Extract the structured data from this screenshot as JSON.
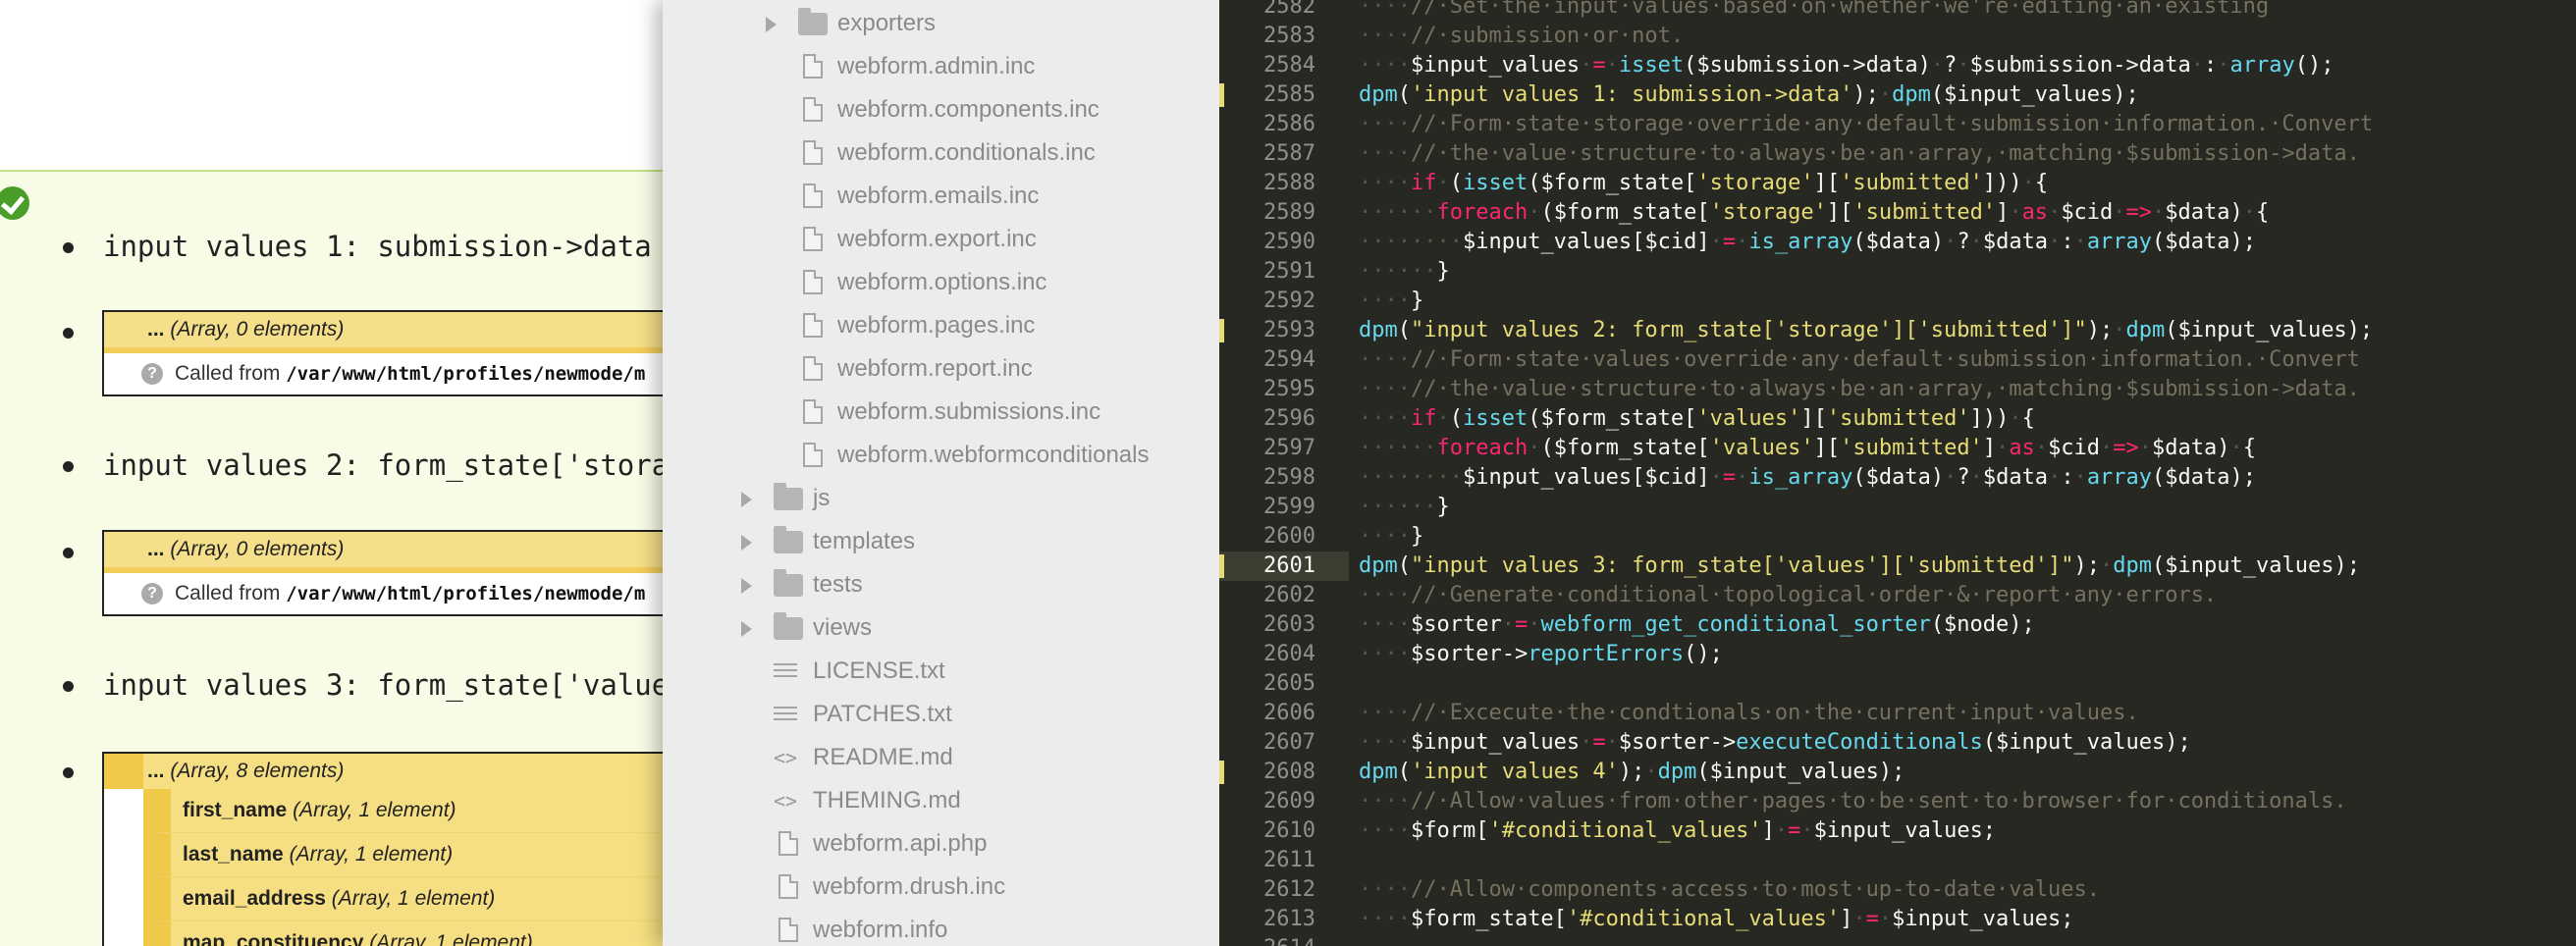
{
  "left_pane": {
    "lines": [
      {
        "text": "input values 1: submission->data"
      },
      {
        "text": "input values 2: form_state['stora"
      },
      {
        "text": "input values 3: form_state['value"
      }
    ],
    "krumo_small": [
      {
        "ellipsis": "...",
        "type": "(Array, 0 elements)",
        "called_from": "Called from",
        "path": "/var/www/html/profiles/newmode/m"
      },
      {
        "ellipsis": "...",
        "type": "(Array, 0 elements)",
        "called_from": "Called from",
        "path": "/var/www/html/profiles/newmode/m"
      }
    ],
    "krumo_big": {
      "ellipsis": "...",
      "type": "(Array, 8 elements)",
      "children": [
        {
          "name": "first_name",
          "type": "(Array, 1 element)"
        },
        {
          "name": "last_name",
          "type": "(Array, 1 element)"
        },
        {
          "name": "email_address",
          "type": "(Array, 1 element)"
        },
        {
          "name": "map_constituency",
          "type": "(Array, 1 element)"
        }
      ]
    }
  },
  "file_tree": {
    "items": [
      {
        "label": "exporters",
        "kind": "folder",
        "expandable": true,
        "depth": 1
      },
      {
        "label": "webform.admin.inc",
        "kind": "file",
        "depth": 1
      },
      {
        "label": "webform.components.inc",
        "kind": "file",
        "depth": 1
      },
      {
        "label": "webform.conditionals.inc",
        "kind": "file",
        "depth": 1
      },
      {
        "label": "webform.emails.inc",
        "kind": "file",
        "depth": 1
      },
      {
        "label": "webform.export.inc",
        "kind": "file",
        "depth": 1
      },
      {
        "label": "webform.options.inc",
        "kind": "file",
        "depth": 1
      },
      {
        "label": "webform.pages.inc",
        "kind": "file",
        "depth": 1
      },
      {
        "label": "webform.report.inc",
        "kind": "file",
        "depth": 1
      },
      {
        "label": "webform.submissions.inc",
        "kind": "file",
        "depth": 1
      },
      {
        "label": "webform.webformconditionals",
        "kind": "file",
        "depth": 1
      },
      {
        "label": "js",
        "kind": "folder",
        "expandable": true,
        "depth": 0
      },
      {
        "label": "templates",
        "kind": "folder",
        "expandable": true,
        "depth": 0
      },
      {
        "label": "tests",
        "kind": "folder",
        "expandable": true,
        "depth": 0
      },
      {
        "label": "views",
        "kind": "folder",
        "expandable": true,
        "depth": 0
      },
      {
        "label": "LICENSE.txt",
        "kind": "text",
        "depth": 0
      },
      {
        "label": "PATCHES.txt",
        "kind": "text",
        "depth": 0
      },
      {
        "label": "README.md",
        "kind": "markdown",
        "depth": 0
      },
      {
        "label": "THEMING.md",
        "kind": "markdown",
        "depth": 0
      },
      {
        "label": "webform.api.php",
        "kind": "file",
        "depth": 0
      },
      {
        "label": "webform.drush.inc",
        "kind": "file",
        "depth": 0
      },
      {
        "label": "webform.info",
        "kind": "file",
        "depth": 0
      }
    ]
  },
  "editor": {
    "active_line": "2601",
    "lines": [
      {
        "num": "2582",
        "tokens": [
          [
            "ws",
            "····"
          ],
          [
            "comment",
            "//·Set·the·input·values·based·on·whether·we're·editing·an·existing"
          ]
        ]
      },
      {
        "num": "2583",
        "tokens": [
          [
            "ws",
            "····"
          ],
          [
            "comment",
            "//·submission·or·not."
          ]
        ]
      },
      {
        "num": "2584",
        "tokens": [
          [
            "ws",
            "····"
          ],
          [
            "var",
            "$input_values"
          ],
          [
            "ws",
            "·"
          ],
          [
            "op",
            "="
          ],
          [
            "ws",
            "·"
          ],
          [
            "fn",
            "isset"
          ],
          [
            "plain",
            "($submission->data)"
          ],
          [
            "ws",
            "·"
          ],
          [
            "plain",
            "?"
          ],
          [
            "ws",
            "·"
          ],
          [
            "plain",
            "$submission->data"
          ],
          [
            "ws",
            "·"
          ],
          [
            "plain",
            ":"
          ],
          [
            "ws",
            "·"
          ],
          [
            "fn",
            "array"
          ],
          [
            "plain",
            "();"
          ]
        ]
      },
      {
        "num": "2585",
        "mark": true,
        "tokens": [
          [
            "fn",
            "dpm"
          ],
          [
            "plain",
            "("
          ],
          [
            "str",
            "'input values 1: submission->data'"
          ],
          [
            "plain",
            ");"
          ],
          [
            "ws",
            "·"
          ],
          [
            "fn",
            "dpm"
          ],
          [
            "plain",
            "($input_values);"
          ]
        ]
      },
      {
        "num": "2586",
        "tokens": [
          [
            "ws",
            "····"
          ],
          [
            "comment",
            "//·Form·state·storage·override·any·default·submission·information.·Convert"
          ]
        ]
      },
      {
        "num": "2587",
        "tokens": [
          [
            "ws",
            "····"
          ],
          [
            "comment",
            "//·the·value·structure·to·always·be·an·array,·matching·$submission->data."
          ]
        ]
      },
      {
        "num": "2588",
        "tokens": [
          [
            "ws",
            "····"
          ],
          [
            "kw",
            "if"
          ],
          [
            "ws",
            "·"
          ],
          [
            "plain",
            "("
          ],
          [
            "fn",
            "isset"
          ],
          [
            "plain",
            "($form_state["
          ],
          [
            "str",
            "'storage'"
          ],
          [
            "plain",
            "]["
          ],
          [
            "str",
            "'submitted'"
          ],
          [
            "plain",
            "]))"
          ],
          [
            "ws",
            "·"
          ],
          [
            "plain",
            "{"
          ]
        ]
      },
      {
        "num": "2589",
        "tokens": [
          [
            "ws",
            "······"
          ],
          [
            "kw",
            "foreach"
          ],
          [
            "ws",
            "·"
          ],
          [
            "plain",
            "($form_state["
          ],
          [
            "str",
            "'storage'"
          ],
          [
            "plain",
            "]["
          ],
          [
            "str",
            "'submitted'"
          ],
          [
            "plain",
            "]"
          ],
          [
            "ws",
            "·"
          ],
          [
            "kw",
            "as"
          ],
          [
            "ws",
            "·"
          ],
          [
            "plain",
            "$cid"
          ],
          [
            "ws",
            "·"
          ],
          [
            "op",
            "=>"
          ],
          [
            "ws",
            "·"
          ],
          [
            "plain",
            "$data)"
          ],
          [
            "ws",
            "·"
          ],
          [
            "plain",
            "{"
          ]
        ]
      },
      {
        "num": "2590",
        "tokens": [
          [
            "ws",
            "········"
          ],
          [
            "plain",
            "$input_values[$cid]"
          ],
          [
            "ws",
            "·"
          ],
          [
            "op",
            "="
          ],
          [
            "ws",
            "·"
          ],
          [
            "fn",
            "is_array"
          ],
          [
            "plain",
            "($data)"
          ],
          [
            "ws",
            "·"
          ],
          [
            "plain",
            "?"
          ],
          [
            "ws",
            "·"
          ],
          [
            "plain",
            "$data"
          ],
          [
            "ws",
            "·"
          ],
          [
            "plain",
            ":"
          ],
          [
            "ws",
            "·"
          ],
          [
            "fn",
            "array"
          ],
          [
            "plain",
            "($data);"
          ]
        ]
      },
      {
        "num": "2591",
        "tokens": [
          [
            "ws",
            "······"
          ],
          [
            "plain",
            "}"
          ]
        ]
      },
      {
        "num": "2592",
        "tokens": [
          [
            "ws",
            "····"
          ],
          [
            "plain",
            "}"
          ]
        ]
      },
      {
        "num": "2593",
        "mark": true,
        "tokens": [
          [
            "fn",
            "dpm"
          ],
          [
            "plain",
            "("
          ],
          [
            "str",
            "\"input values 2: form_state['storage']['submitted']\""
          ],
          [
            "plain",
            ");"
          ],
          [
            "ws",
            "·"
          ],
          [
            "fn",
            "dpm"
          ],
          [
            "plain",
            "($input_values);"
          ]
        ]
      },
      {
        "num": "2594",
        "tokens": [
          [
            "ws",
            "····"
          ],
          [
            "comment",
            "//·Form·state·values·override·any·default·submission·information.·Convert"
          ]
        ]
      },
      {
        "num": "2595",
        "tokens": [
          [
            "ws",
            "····"
          ],
          [
            "comment",
            "//·the·value·structure·to·always·be·an·array,·matching·$submission->data."
          ]
        ]
      },
      {
        "num": "2596",
        "tokens": [
          [
            "ws",
            "····"
          ],
          [
            "kw",
            "if"
          ],
          [
            "ws",
            "·"
          ],
          [
            "plain",
            "("
          ],
          [
            "fn",
            "isset"
          ],
          [
            "plain",
            "($form_state["
          ],
          [
            "str",
            "'values'"
          ],
          [
            "plain",
            "]["
          ],
          [
            "str",
            "'submitted'"
          ],
          [
            "plain",
            "]))"
          ],
          [
            "ws",
            "·"
          ],
          [
            "plain",
            "{"
          ]
        ]
      },
      {
        "num": "2597",
        "tokens": [
          [
            "ws",
            "······"
          ],
          [
            "kw",
            "foreach"
          ],
          [
            "ws",
            "·"
          ],
          [
            "plain",
            "($form_state["
          ],
          [
            "str",
            "'values'"
          ],
          [
            "plain",
            "]["
          ],
          [
            "str",
            "'submitted'"
          ],
          [
            "plain",
            "]"
          ],
          [
            "ws",
            "·"
          ],
          [
            "kw",
            "as"
          ],
          [
            "ws",
            "·"
          ],
          [
            "plain",
            "$cid"
          ],
          [
            "ws",
            "·"
          ],
          [
            "op",
            "=>"
          ],
          [
            "ws",
            "·"
          ],
          [
            "plain",
            "$data)"
          ],
          [
            "ws",
            "·"
          ],
          [
            "plain",
            "{"
          ]
        ]
      },
      {
        "num": "2598",
        "tokens": [
          [
            "ws",
            "········"
          ],
          [
            "plain",
            "$input_values[$cid]"
          ],
          [
            "ws",
            "·"
          ],
          [
            "op",
            "="
          ],
          [
            "ws",
            "·"
          ],
          [
            "fn",
            "is_array"
          ],
          [
            "plain",
            "($data)"
          ],
          [
            "ws",
            "·"
          ],
          [
            "plain",
            "?"
          ],
          [
            "ws",
            "·"
          ],
          [
            "plain",
            "$data"
          ],
          [
            "ws",
            "·"
          ],
          [
            "plain",
            ":"
          ],
          [
            "ws",
            "·"
          ],
          [
            "fn",
            "array"
          ],
          [
            "plain",
            "($data);"
          ]
        ]
      },
      {
        "num": "2599",
        "tokens": [
          [
            "ws",
            "······"
          ],
          [
            "plain",
            "}"
          ]
        ]
      },
      {
        "num": "2600",
        "tokens": [
          [
            "ws",
            "····"
          ],
          [
            "plain",
            "}"
          ]
        ]
      },
      {
        "num": "2601",
        "mark": true,
        "tokens": [
          [
            "fn",
            "dpm"
          ],
          [
            "plain",
            "("
          ],
          [
            "str",
            "\"input values 3: form_state['values']['submitted']\""
          ],
          [
            "plain",
            ");"
          ],
          [
            "ws",
            "·"
          ],
          [
            "fn",
            "dpm"
          ],
          [
            "plain",
            "($input_values);"
          ]
        ]
      },
      {
        "num": "2602",
        "tokens": [
          [
            "ws",
            "····"
          ],
          [
            "comment",
            "//·Generate·conditional·topological·order·&·report·any·errors."
          ]
        ]
      },
      {
        "num": "2603",
        "tokens": [
          [
            "ws",
            "····"
          ],
          [
            "plain",
            "$sorter"
          ],
          [
            "ws",
            "·"
          ],
          [
            "op",
            "="
          ],
          [
            "ws",
            "·"
          ],
          [
            "fn",
            "webform_get_conditional_sorter"
          ],
          [
            "plain",
            "($node);"
          ]
        ]
      },
      {
        "num": "2604",
        "tokens": [
          [
            "ws",
            "····"
          ],
          [
            "plain",
            "$sorter->"
          ],
          [
            "fn",
            "reportErrors"
          ],
          [
            "plain",
            "();"
          ]
        ]
      },
      {
        "num": "2605",
        "tokens": []
      },
      {
        "num": "2606",
        "tokens": [
          [
            "ws",
            "····"
          ],
          [
            "comment",
            "//·Excecute·the·condtionals·on·the·current·input·values."
          ]
        ]
      },
      {
        "num": "2607",
        "tokens": [
          [
            "ws",
            "····"
          ],
          [
            "plain",
            "$input_values"
          ],
          [
            "ws",
            "·"
          ],
          [
            "op",
            "="
          ],
          [
            "ws",
            "·"
          ],
          [
            "plain",
            "$sorter->"
          ],
          [
            "fn",
            "executeConditionals"
          ],
          [
            "plain",
            "($input_values);"
          ]
        ]
      },
      {
        "num": "2608",
        "mark": true,
        "tokens": [
          [
            "fn",
            "dpm"
          ],
          [
            "plain",
            "("
          ],
          [
            "str",
            "'input values 4'"
          ],
          [
            "plain",
            ");"
          ],
          [
            "ws",
            "·"
          ],
          [
            "fn",
            "dpm"
          ],
          [
            "plain",
            "($input_values);"
          ]
        ]
      },
      {
        "num": "2609",
        "tokens": [
          [
            "ws",
            "····"
          ],
          [
            "comment",
            "//·Allow·values·from·other·pages·to·be·sent·to·browser·for·conditionals."
          ]
        ]
      },
      {
        "num": "2610",
        "tokens": [
          [
            "ws",
            "····"
          ],
          [
            "plain",
            "$form["
          ],
          [
            "str",
            "'#conditional_values'"
          ],
          [
            "plain",
            "]"
          ],
          [
            "ws",
            "·"
          ],
          [
            "op",
            "="
          ],
          [
            "ws",
            "·"
          ],
          [
            "plain",
            "$input_values;"
          ]
        ]
      },
      {
        "num": "2611",
        "tokens": []
      },
      {
        "num": "2612",
        "tokens": [
          [
            "ws",
            "····"
          ],
          [
            "comment",
            "//·Allow·components·access·to·most·up-to-date·values."
          ]
        ]
      },
      {
        "num": "2613",
        "tokens": [
          [
            "ws",
            "····"
          ],
          [
            "plain",
            "$form_state["
          ],
          [
            "str",
            "'#conditional_values'"
          ],
          [
            "plain",
            "]"
          ],
          [
            "ws",
            "·"
          ],
          [
            "op",
            "="
          ],
          [
            "ws",
            "·"
          ],
          [
            "plain",
            "$input_values;"
          ]
        ]
      },
      {
        "num": "2614",
        "tokens": []
      }
    ]
  }
}
